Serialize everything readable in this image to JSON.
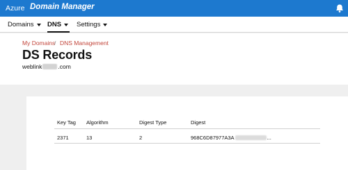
{
  "topbar": {
    "brand_left": "Azure",
    "brand_app": "Domain Manager",
    "bell_icon": "bell-icon",
    "color": "#1d79cf"
  },
  "nav": {
    "items": [
      {
        "label": "Domains",
        "active": false
      },
      {
        "label": "DNS",
        "active": true
      },
      {
        "label": "Settings",
        "active": false
      }
    ]
  },
  "breadcrumb": {
    "items": [
      "My Domains",
      "DNS Management"
    ],
    "separator": "/",
    "color": "#c2453a"
  },
  "page": {
    "title": "DS Records",
    "domain_prefix": "weblink",
    "domain_suffix": ".com"
  },
  "table": {
    "headers": [
      "Key Tag",
      "Algorithm",
      "Digest Type",
      "Digest"
    ],
    "rows": [
      {
        "key_tag": "2371",
        "algorithm": "13",
        "digest_type": "2",
        "digest_prefix": "968C6D87977A3A",
        "digest_suffix": "..."
      }
    ]
  }
}
